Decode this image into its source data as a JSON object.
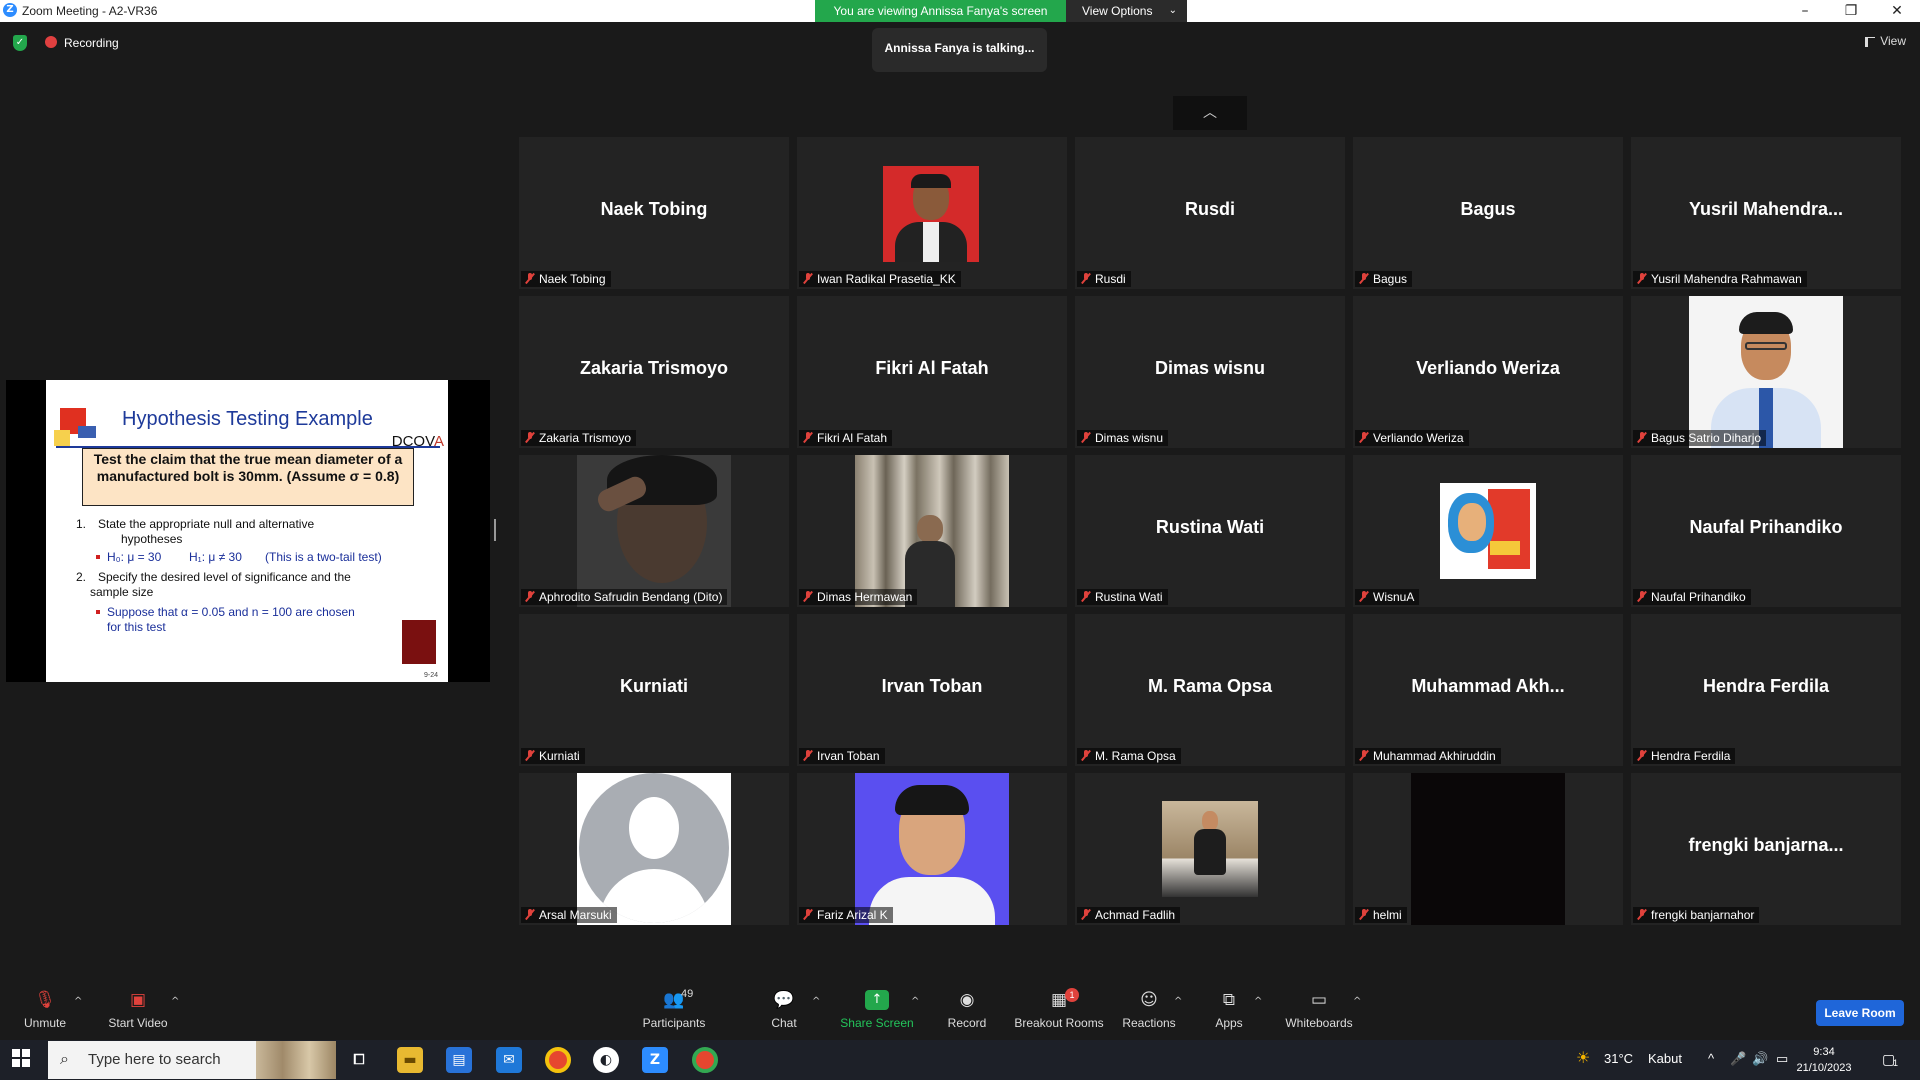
{
  "window": {
    "title": "Zoom Meeting - A2-VR36",
    "sharing_banner": "You are viewing Annissa Fanya's screen",
    "view_options": "View Options"
  },
  "status": {
    "recording": "Recording",
    "talking": "Annissa Fanya is talking...",
    "view": "View"
  },
  "slide": {
    "title": "Hypothesis Testing Example",
    "brand": "DCOV",
    "brand_accent": "A",
    "claim": "Test the claim that the true mean diameter of a manufactured bolt is 30mm. (Assume σ = 0.8)",
    "step1_num": "1.",
    "step1": "State the appropriate null and alternative",
    "step1b": "hypotheses",
    "hyp_h0": "H₀: μ = 30",
    "hyp_h1": "H₁: μ ≠ 30",
    "hyp_note": "(This is a two-tail test)",
    "step2_num": "2.",
    "step2": "Specify the desired level of significance and the",
    "step2b": "sample size",
    "suppose": "Suppose that α = 0.05 and n = 100 are chosen",
    "suppose_b": "for this test",
    "page_no": "9-24"
  },
  "participants": [
    {
      "display": "Naek Tobing",
      "name": "Naek Tobing"
    },
    {
      "display": "",
      "name": "Iwan Radikal Prasetia_KK"
    },
    {
      "display": "Rusdi",
      "name": "Rusdi"
    },
    {
      "display": "Bagus",
      "name": "Bagus"
    },
    {
      "display": "Yusril Mahendra...",
      "name": "Yusril Mahendra Rahmawan"
    },
    {
      "display": "Zakaria Trismoyo",
      "name": "Zakaria Trismoyo"
    },
    {
      "display": "Fikri Al Fatah",
      "name": "Fikri Al Fatah"
    },
    {
      "display": "Dimas wisnu",
      "name": "Dimas wisnu"
    },
    {
      "display": "Verliando Weriza",
      "name": "Verliando Weriza"
    },
    {
      "display": "",
      "name": "Bagus Satrio Diharjo"
    },
    {
      "display": "",
      "name": "Aphrodito Safrudin Bendang (Dito)"
    },
    {
      "display": "",
      "name": "Dimas Hermawan"
    },
    {
      "display": "Rustina Wati",
      "name": "Rustina Wati"
    },
    {
      "display": "",
      "name": "WisnuA"
    },
    {
      "display": "Naufal Prihandiko",
      "name": "Naufal Prihandiko"
    },
    {
      "display": "Kurniati",
      "name": "Kurniati"
    },
    {
      "display": "Irvan Toban",
      "name": "Irvan Toban"
    },
    {
      "display": "M. Rama Opsa",
      "name": "M. Rama Opsa"
    },
    {
      "display": "Muhammad Akh...",
      "name": "Muhammad Akhiruddin"
    },
    {
      "display": "Hendra Ferdila",
      "name": "Hendra Ferdila"
    },
    {
      "display": "",
      "name": "Arsal Marsuki"
    },
    {
      "display": "",
      "name": "Fariz Arizal K"
    },
    {
      "display": "",
      "name": "Achmad Fadlih"
    },
    {
      "display": "",
      "name": "helmi"
    },
    {
      "display": "frengki banjarna...",
      "name": "frengki banjarnahor"
    }
  ],
  "toolbar": {
    "unmute": "Unmute",
    "start_video": "Start Video",
    "participants": "Participants",
    "participants_count": "49",
    "chat": "Chat",
    "share_screen": "Share Screen",
    "record": "Record",
    "breakout_rooms": "Breakout Rooms",
    "breakout_badge": "1",
    "reactions": "Reactions",
    "apps": "Apps",
    "whiteboards": "Whiteboards",
    "leave": "Leave Room"
  },
  "taskbar": {
    "search_placeholder": "Type here to search",
    "weather_temp": "31°C",
    "weather_desc": "Kabut",
    "time": "9:34",
    "date": "21/10/2023",
    "notif_count": "1"
  },
  "colors": {
    "sharing_green": "#23a74c",
    "leave_blue": "#1f66d9",
    "muted_red": "#e0423c",
    "slide_title_blue": "#1e3a9a"
  }
}
